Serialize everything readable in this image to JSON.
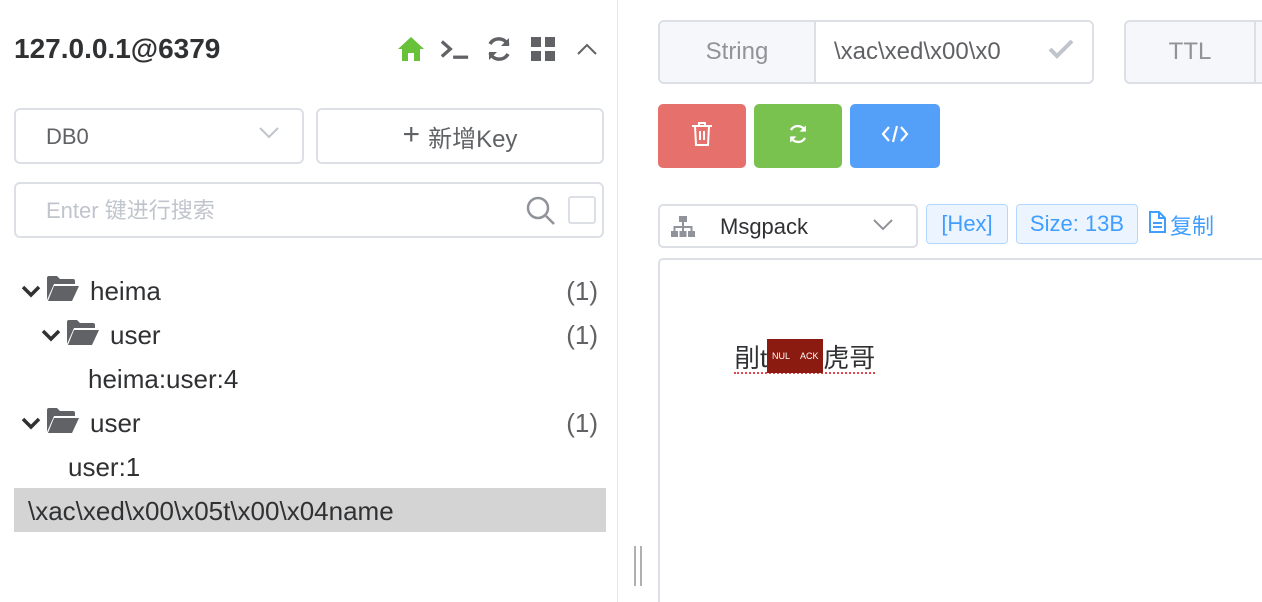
{
  "connection": {
    "title": "127.0.0.1@6379",
    "icons": [
      "home-icon",
      "terminal-icon",
      "refresh-icon",
      "grid-icon",
      "chevron-up-icon"
    ],
    "home_color": "#67c23a"
  },
  "db_select": {
    "value": "DB0"
  },
  "new_key": {
    "label": "新增Key"
  },
  "search": {
    "placeholder": "Enter 键进行搜索"
  },
  "tree": [
    {
      "label": "heima",
      "count": "(1)"
    },
    {
      "label": "user",
      "count": "(1)"
    },
    {
      "label": "heima:user:4"
    },
    {
      "label": "user",
      "count": "(1)"
    },
    {
      "label": "user:1"
    },
    {
      "label": "\\xac\\xed\\x00\\x05t\\x00\\x04name",
      "selected": true
    }
  ],
  "key_header": {
    "type": "String",
    "key_name": "\\xac\\xed\\x00\\x0",
    "ttl_label": "TTL"
  },
  "actions": {
    "delete_color": "#e6706b",
    "refresh_color": "#7ac250",
    "code_color": "#549ff8"
  },
  "format": {
    "selected": "Msgpack",
    "hex_tag": "[Hex]",
    "size_tag": "Size: 13B",
    "copy_label": "复制"
  },
  "value": {
    "prefix": "剈t",
    "control_chars": [
      "NUL",
      "ACK"
    ],
    "suffix": "虎哥"
  }
}
